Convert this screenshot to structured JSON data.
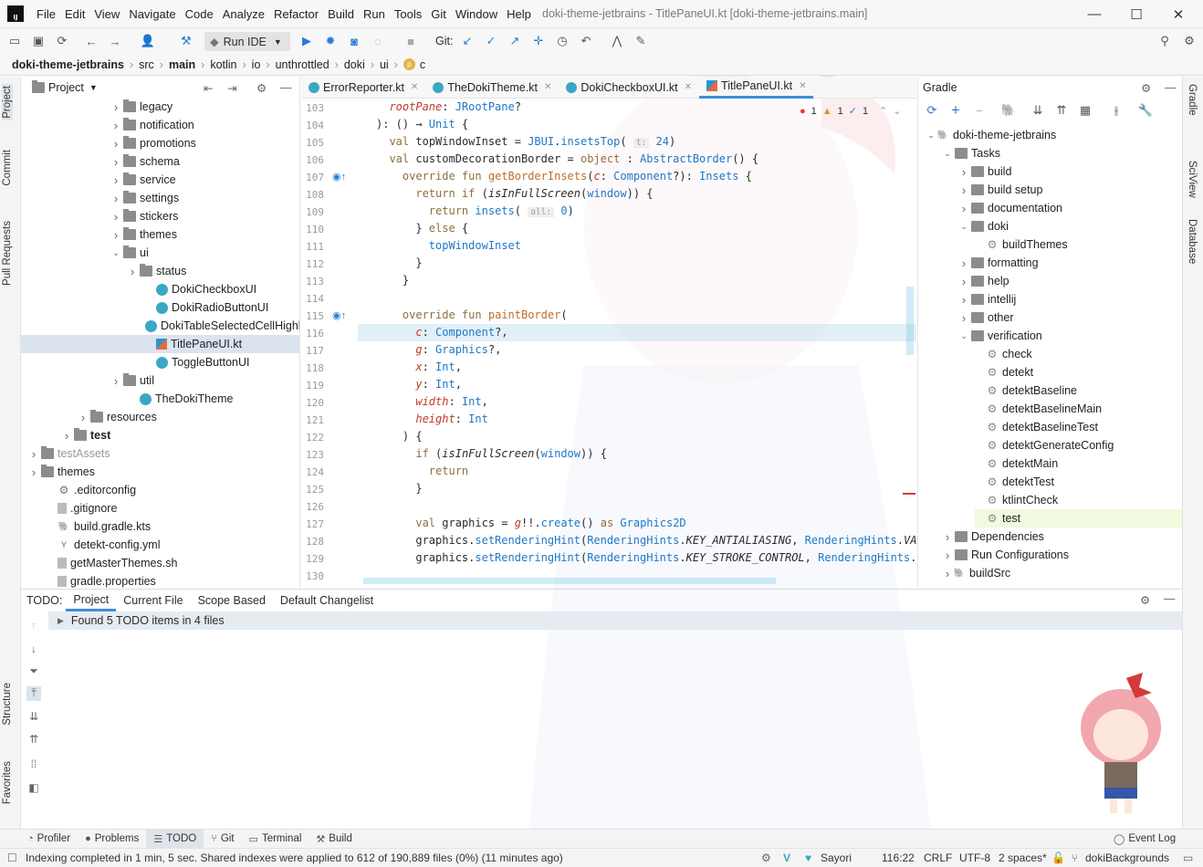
{
  "app": {
    "logo_text": "IJ",
    "window_title": "doki-theme-jetbrains - TitlePaneUI.kt [doki-theme-jetbrains.main]",
    "menu": [
      "File",
      "Edit",
      "View",
      "Navigate",
      "Code",
      "Analyze",
      "Refactor",
      "Build",
      "Run",
      "Tools",
      "Git",
      "Window",
      "Help"
    ]
  },
  "toolbar": {
    "run_config": "Run IDE",
    "git_label": "Git:"
  },
  "navbar": {
    "crumbs": [
      "doki-theme-jetbrains",
      "src",
      "main",
      "kotlin",
      "io",
      "unthrottled",
      "doki",
      "ui",
      "c"
    ]
  },
  "left_strip": {
    "project": "Project",
    "commit": "Commit",
    "pull_requests": "Pull Requests",
    "structure": "Structure",
    "favorites": "Favorites"
  },
  "right_strip": {
    "gradle": "Gradle",
    "sciview": "SciView",
    "database": "Database"
  },
  "project_panel": {
    "title": "Project",
    "items": [
      {
        "label": "legacy",
        "indent": 5,
        "kind": "folder",
        "exp": "closed"
      },
      {
        "label": "notification",
        "indent": 5,
        "kind": "folder",
        "exp": "closed"
      },
      {
        "label": "promotions",
        "indent": 5,
        "kind": "folder",
        "exp": "closed"
      },
      {
        "label": "schema",
        "indent": 5,
        "kind": "folder",
        "exp": "closed"
      },
      {
        "label": "service",
        "indent": 5,
        "kind": "folder",
        "exp": "closed"
      },
      {
        "label": "settings",
        "indent": 5,
        "kind": "folder",
        "exp": "closed"
      },
      {
        "label": "stickers",
        "indent": 5,
        "kind": "folder",
        "exp": "closed"
      },
      {
        "label": "themes",
        "indent": 5,
        "kind": "folder",
        "exp": "closed"
      },
      {
        "label": "ui",
        "indent": 5,
        "kind": "folder",
        "exp": "open"
      },
      {
        "label": "status",
        "indent": 6,
        "kind": "folder",
        "exp": "closed"
      },
      {
        "label": "DokiCheckboxUI",
        "indent": 7,
        "kind": "kt",
        "exp": ""
      },
      {
        "label": "DokiRadioButtonUI",
        "indent": 7,
        "kind": "kt",
        "exp": ""
      },
      {
        "label": "DokiTableSelectedCellHighlightB",
        "indent": 7,
        "kind": "kt",
        "exp": ""
      },
      {
        "label": "TitlePaneUI.kt",
        "indent": 7,
        "kind": "kf",
        "exp": "",
        "selected": true
      },
      {
        "label": "ToggleButtonUI",
        "indent": 7,
        "kind": "kt",
        "exp": ""
      },
      {
        "label": "util",
        "indent": 5,
        "kind": "folder",
        "exp": "closed"
      },
      {
        "label": "TheDokiTheme",
        "indent": 6,
        "kind": "kt",
        "exp": ""
      },
      {
        "label": "resources",
        "indent": 3,
        "kind": "folder",
        "exp": "closed"
      },
      {
        "label": "test",
        "indent": 2,
        "kind": "folder",
        "exp": "closed",
        "bold": true
      },
      {
        "label": "testAssets",
        "indent": 0,
        "kind": "folder",
        "exp": "closed",
        "muted": true
      },
      {
        "label": "themes",
        "indent": 0,
        "kind": "folder",
        "exp": "closed"
      },
      {
        "label": ".editorconfig",
        "indent": 1,
        "kind": "gear",
        "exp": ""
      },
      {
        "label": ".gitignore",
        "indent": 1,
        "kind": "file",
        "exp": ""
      },
      {
        "label": "build.gradle.kts",
        "indent": 1,
        "kind": "gradle",
        "exp": ""
      },
      {
        "label": "detekt-config.yml",
        "indent": 1,
        "kind": "yml",
        "exp": ""
      },
      {
        "label": "getMasterThemes.sh",
        "indent": 1,
        "kind": "file",
        "exp": ""
      },
      {
        "label": "gradle.properties",
        "indent": 1,
        "kind": "file",
        "exp": ""
      }
    ]
  },
  "editor": {
    "tabs": [
      {
        "label": "ErrorReporter.kt",
        "active": false
      },
      {
        "label": "TheDokiTheme.kt",
        "active": false
      },
      {
        "label": "DokiCheckboxUI.kt",
        "active": false
      },
      {
        "label": "TitlePaneUI.kt",
        "active": true
      }
    ],
    "inspections": {
      "errors": "1",
      "warnings": "1",
      "typos": "1"
    },
    "line_numbers": [
      "103",
      "104",
      "105",
      "106",
      "107",
      "108",
      "109",
      "110",
      "111",
      "112",
      "113",
      "114",
      "115",
      "116",
      "117",
      "118",
      "119",
      "120",
      "121",
      "122",
      "123",
      "124",
      "125",
      "126",
      "127",
      "128",
      "129",
      "130"
    ],
    "hint_t": "t:",
    "hint_t_val": "24",
    "hint_all": "all:",
    "hint_all_val": "0"
  },
  "gradle_panel": {
    "title": "Gradle",
    "nodes": [
      {
        "label": "doki-theme-jetbrains",
        "level": 0,
        "exp": "open",
        "kind": "root"
      },
      {
        "label": "Tasks",
        "level": 1,
        "exp": "open",
        "kind": "group"
      },
      {
        "label": "build",
        "level": 2,
        "exp": "closed",
        "kind": "group"
      },
      {
        "label": "build setup",
        "level": 2,
        "exp": "closed",
        "kind": "group"
      },
      {
        "label": "documentation",
        "level": 2,
        "exp": "closed",
        "kind": "group"
      },
      {
        "label": "doki",
        "level": 2,
        "exp": "open",
        "kind": "group"
      },
      {
        "label": "buildThemes",
        "level": 3,
        "exp": "",
        "kind": "task"
      },
      {
        "label": "formatting",
        "level": 2,
        "exp": "closed",
        "kind": "group"
      },
      {
        "label": "help",
        "level": 2,
        "exp": "closed",
        "kind": "group"
      },
      {
        "label": "intellij",
        "level": 2,
        "exp": "closed",
        "kind": "group"
      },
      {
        "label": "other",
        "level": 2,
        "exp": "closed",
        "kind": "group"
      },
      {
        "label": "verification",
        "level": 2,
        "exp": "open",
        "kind": "group"
      },
      {
        "label": "check",
        "level": 3,
        "exp": "",
        "kind": "task"
      },
      {
        "label": "detekt",
        "level": 3,
        "exp": "",
        "kind": "task"
      },
      {
        "label": "detektBaseline",
        "level": 3,
        "exp": "",
        "kind": "task"
      },
      {
        "label": "detektBaselineMain",
        "level": 3,
        "exp": "",
        "kind": "task"
      },
      {
        "label": "detektBaselineTest",
        "level": 3,
        "exp": "",
        "kind": "task"
      },
      {
        "label": "detektGenerateConfig",
        "level": 3,
        "exp": "",
        "kind": "task"
      },
      {
        "label": "detektMain",
        "level": 3,
        "exp": "",
        "kind": "task"
      },
      {
        "label": "detektTest",
        "level": 3,
        "exp": "",
        "kind": "task"
      },
      {
        "label": "ktlintCheck",
        "level": 3,
        "exp": "",
        "kind": "task"
      },
      {
        "label": "test",
        "level": 3,
        "exp": "",
        "kind": "task"
      },
      {
        "label": "Dependencies",
        "level": 1,
        "exp": "closed",
        "kind": "group"
      },
      {
        "label": "Run Configurations",
        "level": 1,
        "exp": "closed",
        "kind": "group"
      },
      {
        "label": "buildSrc",
        "level": 1,
        "exp": "closed",
        "kind": "root"
      }
    ]
  },
  "todo": {
    "label": "TODO:",
    "tabs": [
      "Project",
      "Current File",
      "Scope Based",
      "Default Changelist"
    ],
    "result": "Found 5 TODO items in 4 files"
  },
  "bottom_tools": [
    {
      "label": "Profiler",
      "icon": "◔",
      "active": false
    },
    {
      "label": "Problems",
      "icon": "●",
      "active": false
    },
    {
      "label": "TODO",
      "icon": "☰",
      "active": true
    },
    {
      "label": "Git",
      "icon": "⑂",
      "active": false
    },
    {
      "label": "Terminal",
      "icon": "▭",
      "active": false
    },
    {
      "label": "Build",
      "icon": "⚒",
      "active": false
    }
  ],
  "event_log": "Event Log",
  "status": {
    "message": "Indexing completed in 1 min, 5 sec. Shared indexes were applied to 612 of 190,889 files (0%) (11 minutes ago)",
    "theme": "Sayori",
    "position": "116:22",
    "line_sep": "CRLF",
    "encoding": "UTF-8",
    "indent": "2 spaces*",
    "branch": "dokiBackgrounds"
  },
  "colors": {
    "accent": "#3f8ddb",
    "selection": "#dbe3ef",
    "keyword": "#8e6f3d",
    "type": "#1f78c8",
    "function": "#c06d2b",
    "param": "#c0392b"
  }
}
